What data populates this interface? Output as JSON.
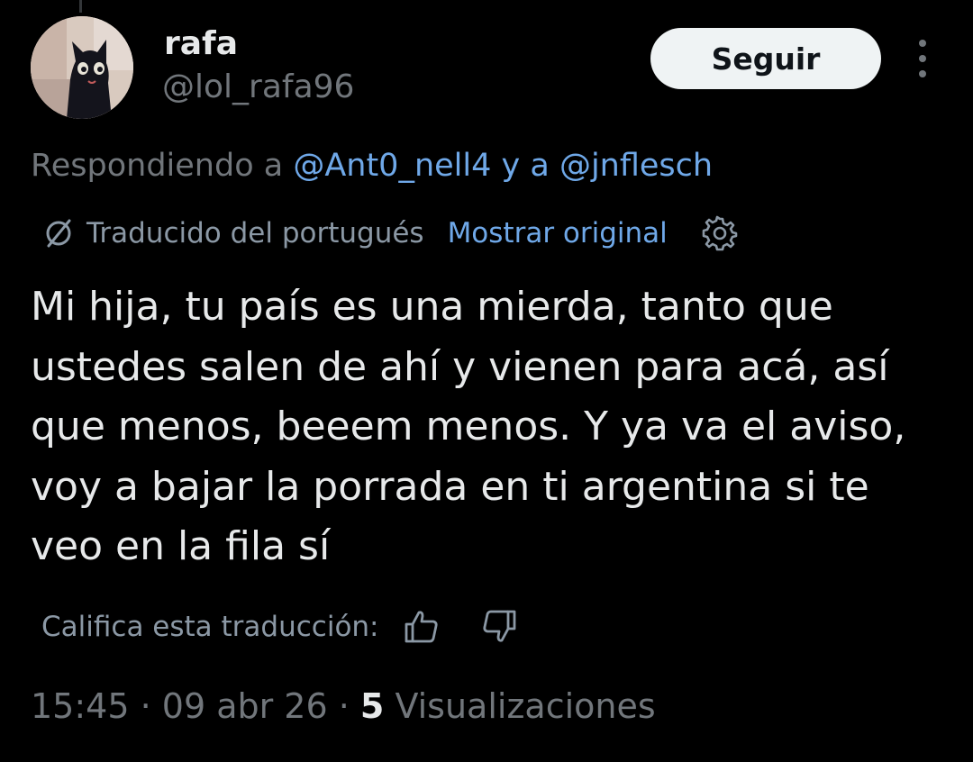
{
  "user": {
    "display_name": "rafa",
    "handle": "@lol_rafa96",
    "avatar_icon": "black-cat-avatar"
  },
  "actions": {
    "follow_label": "Seguir",
    "more_icon": "more-vertical-icon"
  },
  "reply_context": {
    "prefix": "Respondiendo a ",
    "mention_1": "@Ant0_nell4",
    "connector": " y a ",
    "mention_2": "@jnflesch"
  },
  "translation": {
    "icon": "translate-icon",
    "label": "Traducido del portugués",
    "show_original": "Mostrar original",
    "settings_icon": "gear-icon"
  },
  "tweet": {
    "text": "Mi hija, tu país es una mierda, tanto que\nustedes salen de ahí y vienen para acá, así\nque menos, beeem menos. Y ya va el aviso,\nvoy a bajar la porrada en ti argentina si te\nveo en la fila sí"
  },
  "rating": {
    "label": "Califica esta traducción:",
    "thumbs_up_icon": "thumbs-up-icon",
    "thumbs_down_icon": "thumbs-down-icon"
  },
  "meta": {
    "time": "15:45",
    "sep1": " · ",
    "date": "09 abr 26",
    "sep2": " · ",
    "views_count": "5",
    "views_label": " Visualizaciones"
  },
  "colors": {
    "background": "#000000",
    "text_primary": "#e7e9ea",
    "text_secondary": "#71767b",
    "link": "#6fa8e8",
    "button_bg": "#eff3f4"
  }
}
